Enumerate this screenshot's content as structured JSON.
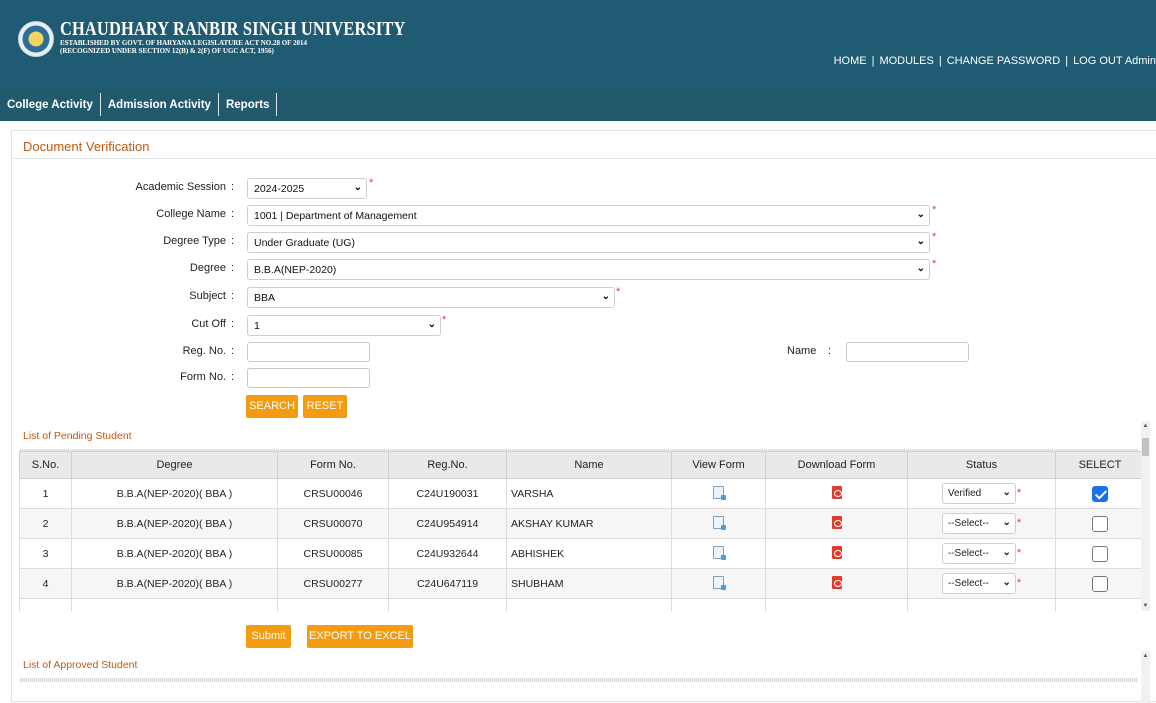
{
  "header": {
    "university_name": "CHAUDHARY RANBIR SINGH UNIVERSITY",
    "subtitle_line1": "ESTABLISHED BY GOVT. OF HARYANA LEGISLATURE ACT NO.28 OF 2014",
    "subtitle_line2": "(RECOGNIZED UNDER SECTION 12(B) & 2(F) OF UGC ACT, 1956)",
    "links": {
      "home": "HOME",
      "modules": "MODULES",
      "change_password": "CHANGE PASSWORD",
      "logout": "LOG OUT Admin",
      "separator": "|"
    }
  },
  "nav": {
    "items": [
      "College Activity",
      "Admission Activity",
      "Reports"
    ]
  },
  "page": {
    "title": "Document Verification"
  },
  "form": {
    "colon": ":",
    "required_mark": "*",
    "academic_session": {
      "label": "Academic Session",
      "value": "2024-2025"
    },
    "college_name": {
      "label": "College Name",
      "value": "1001 | Department of Management"
    },
    "degree_type": {
      "label": "Degree Type",
      "value": "Under Graduate (UG)"
    },
    "degree": {
      "label": "Degree",
      "value": "B.B.A(NEP-2020)"
    },
    "subject": {
      "label": "Subject",
      "value": "BBA"
    },
    "cut_off": {
      "label": "Cut Off",
      "value": "1"
    },
    "reg_no": {
      "label": "Reg. No.",
      "value": ""
    },
    "name": {
      "label": "Name",
      "value": ""
    },
    "form_no": {
      "label": "Form No.",
      "value": ""
    },
    "search_label": "SEARCH",
    "reset_label": "RESET"
  },
  "pending": {
    "section_title": "List of Pending Student",
    "columns": [
      "S.No.",
      "Degree",
      "Form No.",
      "Reg.No.",
      "Name",
      "View Form",
      "Download Form",
      "Status",
      "SELECT"
    ],
    "rows": [
      {
        "sno": "1",
        "degree": "B.B.A(NEP-2020)( BBA )",
        "form_no": "CRSU00046",
        "reg_no": "C24U190031",
        "name": "VARSHA",
        "status": "Verified",
        "selected": true
      },
      {
        "sno": "2",
        "degree": "B.B.A(NEP-2020)( BBA )",
        "form_no": "CRSU00070",
        "reg_no": "C24U954914",
        "name": "AKSHAY KUMAR",
        "status": "--Select--",
        "selected": false
      },
      {
        "sno": "3",
        "degree": "B.B.A(NEP-2020)( BBA )",
        "form_no": "CRSU00085",
        "reg_no": "C24U932644",
        "name": "ABHISHEK",
        "status": "--Select--",
        "selected": false
      },
      {
        "sno": "4",
        "degree": "B.B.A(NEP-2020)( BBA )",
        "form_no": "CRSU00277",
        "reg_no": "C24U647119",
        "name": "SHUBHAM",
        "status": "--Select--",
        "selected": false
      }
    ],
    "submit_label": "Submit",
    "export_label": "EXPORT TO EXCEL"
  },
  "approved": {
    "section_title": "List of Approved Student"
  },
  "colors": {
    "header_bg": "#1f5c73",
    "nav_bg": "#225a6d",
    "accent_orange": "#f39c12",
    "title_orange": "#c15a14",
    "required_red": "#e23a3a",
    "checkbox_blue": "#1a73e8"
  },
  "icons": {
    "logo": "university-seal",
    "view_form": "document-icon",
    "download_form": "pdf-icon",
    "dropdown": "chevron-down-icon"
  }
}
